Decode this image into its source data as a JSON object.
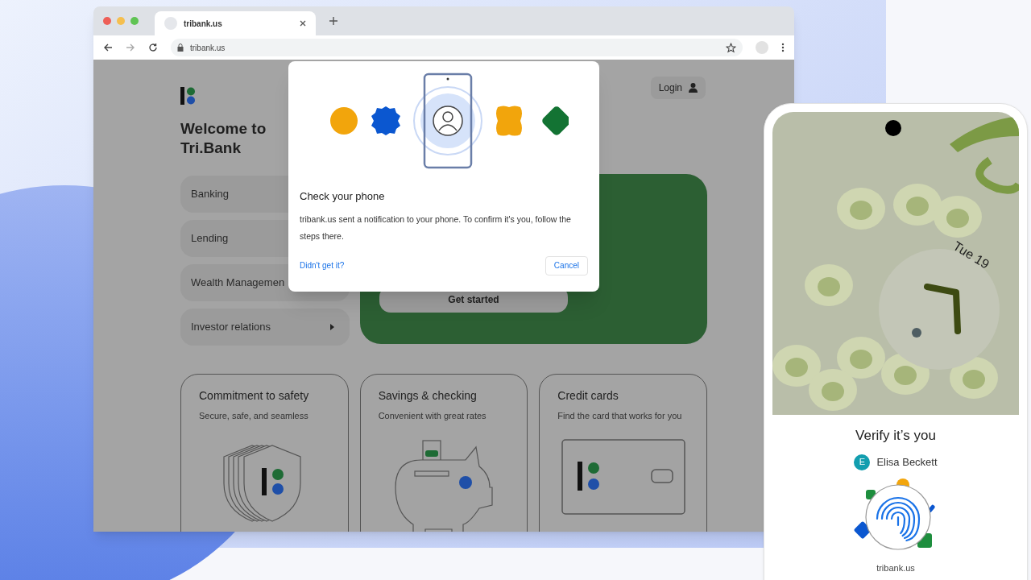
{
  "browser": {
    "tab_title": "tribank.us",
    "url": "tribank.us"
  },
  "page": {
    "heading": "Welcome to Tri.Bank",
    "login": "Login",
    "menu": [
      {
        "label": "Banking"
      },
      {
        "label": "Lending"
      },
      {
        "label": "Wealth Managemen"
      },
      {
        "label": "Investor relations",
        "expandable": true
      }
    ],
    "hero": {
      "button": "Get started"
    },
    "cards": [
      {
        "kind": "shield",
        "title": "Commitment to safety",
        "subtitle": "Secure, safe, and seamless"
      },
      {
        "kind": "piggy",
        "title": "Savings & checking",
        "subtitle": "Convenient with great rates"
      },
      {
        "kind": "card",
        "title": "Credit cards",
        "subtitle": "Find the card that works for you"
      }
    ]
  },
  "dialog": {
    "title": "Check your phone",
    "message": "tribank.us sent a notification to your phone. To confirm it's you, follow the steps there.",
    "link": "Didn't get it?",
    "button": "Cancel"
  },
  "phone": {
    "date": "Tue 19",
    "sheet_title": "Verify it’s you",
    "account_initial": "E",
    "account_name": "Elisa Beckett",
    "site": "tribank.us"
  }
}
